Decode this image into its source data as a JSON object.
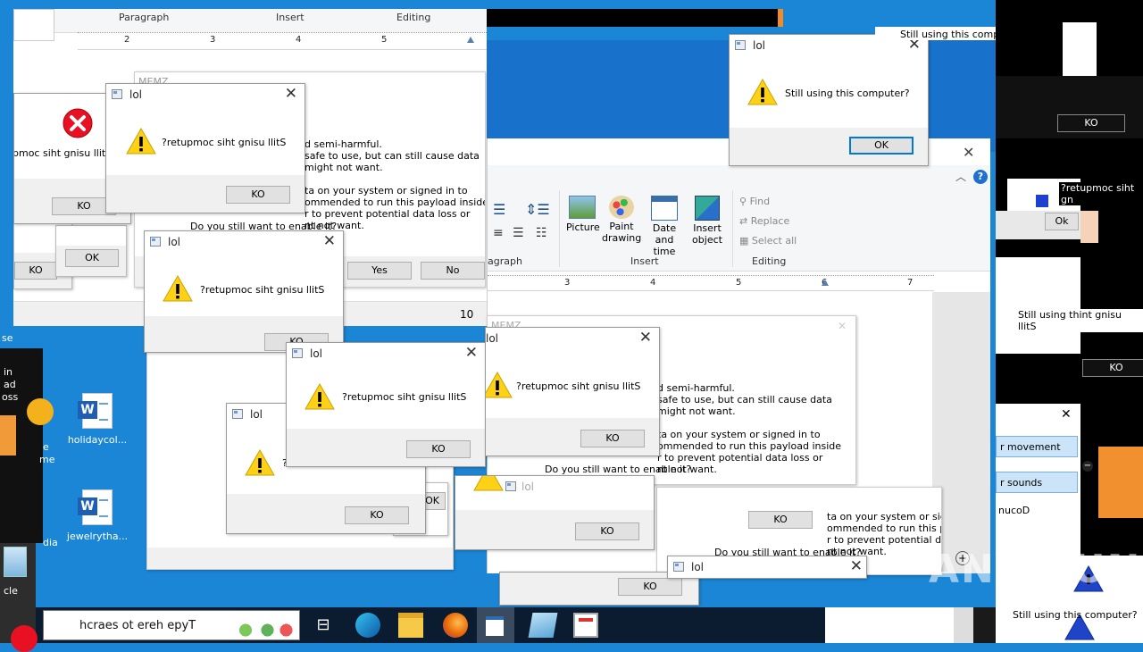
{
  "wordpad_top": {
    "groups": [
      "Paragraph",
      "Insert",
      "Editing"
    ],
    "ruler": [
      "2",
      "3",
      "4",
      "5"
    ],
    "page_num": "10"
  },
  "memz_dialog_back": {
    "title": "MEMZ",
    "body": [
      "d semi-harmful.",
      "safe to use, but can still cause data",
      "might not want.",
      "",
      "ta on your system or signed in to",
      "ommended to run this payload inside",
      "r to prevent potential data loss or",
      "nt not want."
    ],
    "question": "Do you still want to enable it?",
    "yes": "Yes",
    "no": "No"
  },
  "dialogs": {
    "error_left": {
      "message": "pmoc siht gnisu llitS",
      "button": "KO"
    },
    "warn_top_left": {
      "title": "lol",
      "message": "?retupmoc siht gnisu llitS",
      "button": "KO"
    },
    "warn_mid": {
      "title": "lol",
      "message": "?retupmoc siht gnisu llitS",
      "button": "KO"
    },
    "warn_bottom_a": {
      "title": "lol",
      "message": "?retupmoc siht gnisu llitS",
      "button": "KO"
    },
    "warn_bottom_b": {
      "title": "lol",
      "message": "?",
      "button": "KO"
    },
    "warn_right_center": {
      "title": "lol",
      "message": "?retupmoc siht gnisu llitS",
      "button": "KO"
    },
    "main_ok": {
      "title": "lol",
      "message": "Still using this computer?",
      "button": "OK"
    },
    "partial_ok_left": {
      "button": "OK"
    },
    "partial_ko_left": {
      "button": "KO"
    },
    "partial_ok_mid": {
      "button": "OK"
    },
    "bottom_center": {
      "title": "lol",
      "button": "KO"
    },
    "bottom_center2": {
      "button": "KO"
    },
    "bottom_right": {
      "title": "lol"
    },
    "right_ko": {
      "button": "KO"
    }
  },
  "wordpad_main": {
    "groups": [
      "agraph",
      "Insert",
      "Editing"
    ],
    "insert_buttons": [
      "Picture",
      "Paint drawing",
      "Date and time",
      "Insert object"
    ],
    "editing_buttons": [
      "Find",
      "Replace",
      "Select all"
    ],
    "ruler": [
      "3",
      "4",
      "5",
      "6",
      "7"
    ]
  },
  "memz_dialog_front": {
    "title": "MEMZ",
    "body": [
      "d semi-harmful.",
      "safe to use, but can still cause data",
      "might not want.",
      "",
      "ta on your system or signed in to",
      "ommended to run this payload inside",
      "r to prevent potential data loss or",
      "nt not want."
    ],
    "question": "Do you still want to enable it?"
  },
  "memz_dialog_lower": {
    "body": [
      "ta on your system or sig",
      "ommended to run this pa",
      "r to prevent potential da",
      "nt not want."
    ],
    "question": "Do you still want to enable it?",
    "button": "KO"
  },
  "right_strip": {
    "top_text": "Still using this comput",
    "ko1": "KO",
    "mirror": "?retupmoc siht gn",
    "ok_btn": "Ok",
    "middle_text": "Still using thint gnisu llitS",
    "ko2": "KO",
    "menu1": "r movement",
    "menu2": "r sounds",
    "cuco": "nucoD",
    "bottom_text": "Still using this computer?"
  },
  "desktop_icons": [
    {
      "label": "holidaycol...",
      "type": "word"
    },
    {
      "label": "jewelrytha...",
      "type": "word"
    }
  ],
  "desktop_partial": [
    "e",
    "me",
    "dia",
    "cle",
    "in",
    "ad",
    "oss",
    "se"
  ],
  "taskbar": {
    "search_text": "hcraes ot ereh epyT"
  },
  "watermark": "ANY RUN"
}
